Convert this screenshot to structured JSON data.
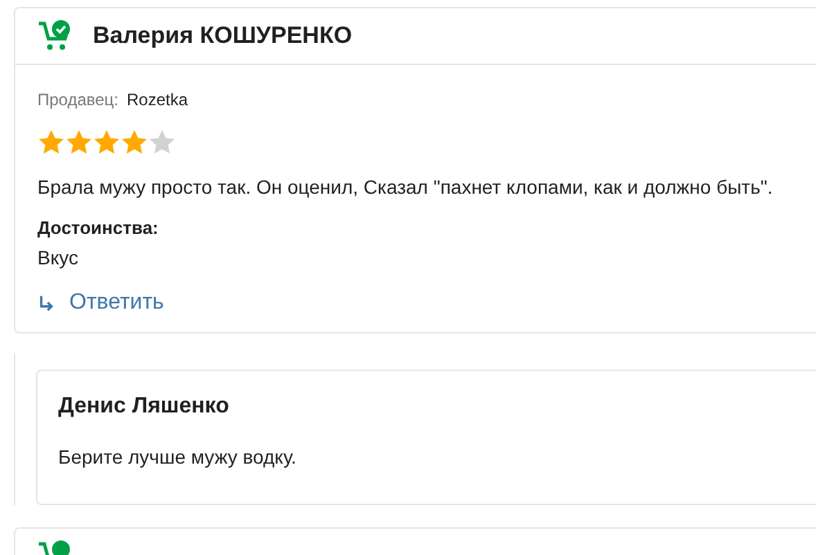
{
  "review": {
    "author": "Валерия КОШУРЕНКО",
    "seller_label": "Продавец:",
    "seller": "Rozetka",
    "stars": 4,
    "text": "Брала мужу просто так. Он оценил, Сказал \"пахнет клопами, как и должно быть\".",
    "pros_label": "Достоинства:",
    "pros": "Вкус",
    "reply_button": "Ответить"
  },
  "reply": {
    "author": "Денис Ляшенко",
    "text": "Берите лучше мужу водку."
  }
}
